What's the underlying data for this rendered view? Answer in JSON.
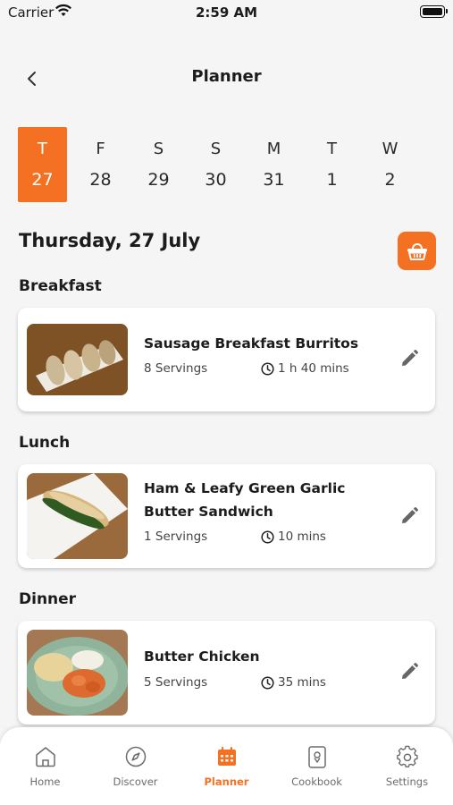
{
  "status_bar": {
    "carrier": "Carrier",
    "time": "2:59 AM"
  },
  "header": {
    "title": "Planner"
  },
  "days": [
    {
      "weekday": "T",
      "date": "27",
      "selected": true
    },
    {
      "weekday": "F",
      "date": "28",
      "selected": false
    },
    {
      "weekday": "S",
      "date": "29",
      "selected": false
    },
    {
      "weekday": "S",
      "date": "30",
      "selected": false
    },
    {
      "weekday": "M",
      "date": "31",
      "selected": false
    },
    {
      "weekday": "T",
      "date": "1",
      "selected": false
    },
    {
      "weekday": "W",
      "date": "2",
      "selected": false
    }
  ],
  "selected_date_heading": "Thursday, 27 July",
  "meals": {
    "breakfast": {
      "label": "Breakfast",
      "name": "Sausage Breakfast Burritos",
      "servings": "8 Servings",
      "time": "1 h 40 mins"
    },
    "lunch": {
      "label": "Lunch",
      "name": "Ham & Leafy Green Garlic Butter Sandwich",
      "servings": "1 Servings",
      "time": "10 mins"
    },
    "dinner": {
      "label": "Dinner",
      "name": "Butter Chicken",
      "servings": "5 Servings",
      "time": "35 mins"
    }
  },
  "tabs": {
    "home": "Home",
    "discover": "Discover",
    "planner": "Planner",
    "cookbook": "Cookbook",
    "settings": "Settings"
  },
  "colors": {
    "accent": "#f47124",
    "background": "#f5f5f5",
    "card": "#ffffff"
  },
  "icons": {
    "back": "chevron-left-icon",
    "basket": "shopping-basket-icon",
    "edit": "pencil-icon",
    "clock": "clock-icon"
  }
}
